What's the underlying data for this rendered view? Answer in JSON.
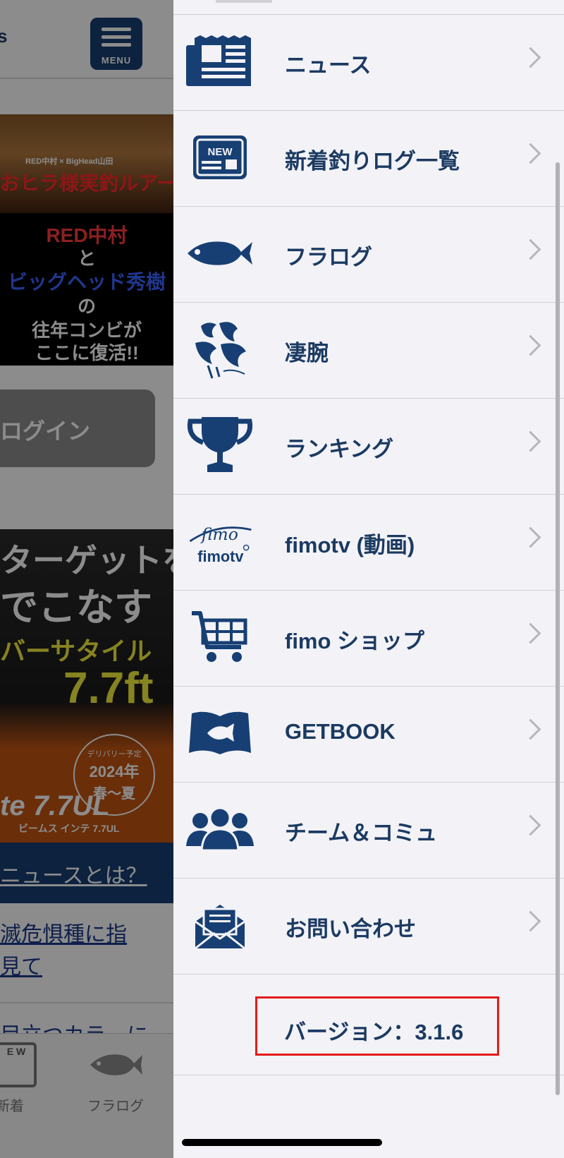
{
  "background": {
    "header_text": "s",
    "menu_button_label": "MENU",
    "banner1": {
      "small_text": "RED中村 × BigHead山田",
      "red_title": "おヒラ様実釣ルアーテスト!!",
      "line1": "RED中村",
      "line2": "と",
      "line3": "ビッグヘッド秀樹",
      "line4": "の",
      "line5": "往年コンビが",
      "line6": "ここに復活!!"
    },
    "login_label": "ログイン",
    "banner2": {
      "t1": "ターゲットを",
      "t2": "でこなす",
      "t3": "バーサタイル",
      "t4": "7.7ft",
      "circle1": "デリバリー予定",
      "circle2": "2024年",
      "circle3": "春〜夏",
      "t5": "te 7.7UL",
      "t6": "ビームス インテ 7.7UL"
    },
    "news_link": "ニュースとは？",
    "article_line1": "滅危惧種に指",
    "article_line2": "見て",
    "article2_partial": "目立つカラーに",
    "tabs": [
      {
        "label": "新着",
        "icon_text": "E W"
      },
      {
        "label": "フラログ"
      }
    ]
  },
  "drawer": {
    "items": [
      {
        "label": "ニュース",
        "icon": "newspaper-icon"
      },
      {
        "label": "新着釣りログ一覧",
        "icon": "new-badge-icon",
        "icon_text": "NEW"
      },
      {
        "label": "フラログ",
        "icon": "fish-icon"
      },
      {
        "label": "凄腕",
        "icon": "sugoude-logo-icon"
      },
      {
        "label": "ランキング",
        "icon": "trophy-icon"
      },
      {
        "label": "fimotv (動画)",
        "icon": "fimotv-logo-icon",
        "icon_text_top": "fimo",
        "icon_text_bottom": "fimotv"
      },
      {
        "label": "fimo ショップ",
        "icon": "cart-icon"
      },
      {
        "label": "GETBOOK",
        "icon": "book-icon"
      },
      {
        "label": "チーム＆コミュ",
        "icon": "team-icon"
      },
      {
        "label": "お問い合わせ",
        "icon": "mail-icon"
      }
    ],
    "version": "バージョン：3.1.6"
  },
  "colors": {
    "navy": "#1b3a61",
    "icon_navy": "#173f73",
    "highlight_red": "#e41b1b",
    "drawer_bg": "#f2f2f7"
  }
}
